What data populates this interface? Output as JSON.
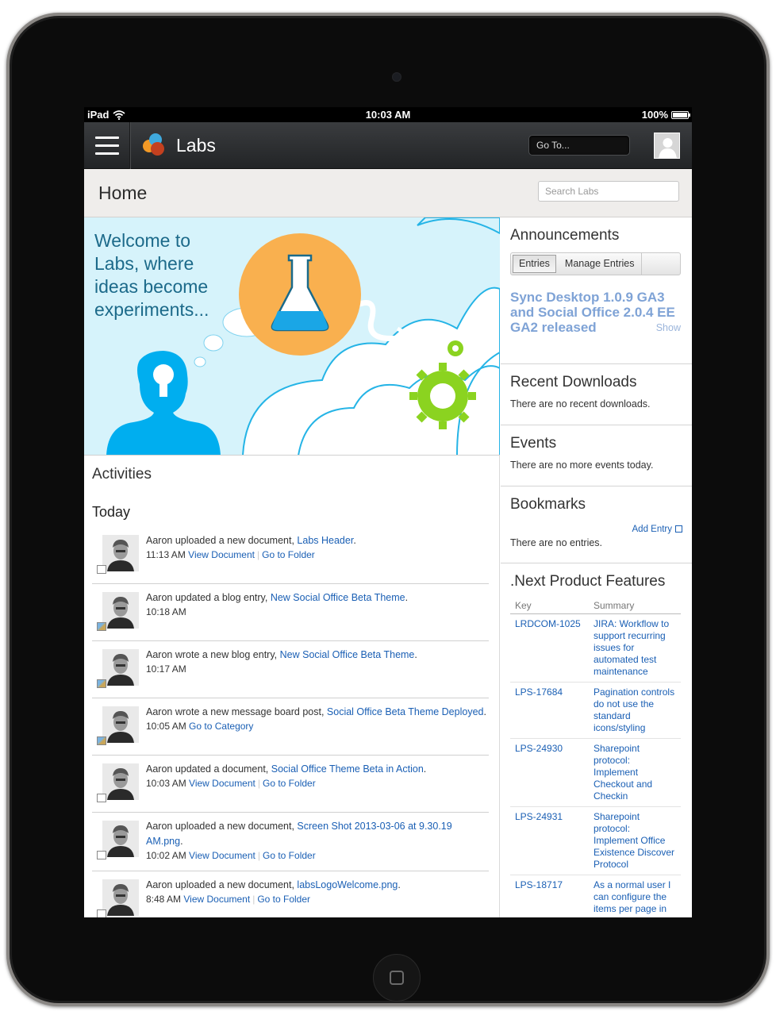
{
  "statusbar": {
    "device": "iPad",
    "time": "10:03 AM",
    "battery": "100%",
    "battery_level": 1.0
  },
  "header": {
    "site_title": "Labs",
    "goto_label": "Go To..."
  },
  "page": {
    "title": "Home",
    "search_placeholder": "Search Labs"
  },
  "banner": {
    "text": "Welcome to Labs, where ideas become experiments..."
  },
  "activities": {
    "title": "Activities",
    "today_label": "Today",
    "items": [
      {
        "text": "Aaron uploaded a new document, ",
        "link": "Labs Header",
        "suffix": ".",
        "time": "11:13 AM",
        "action1": "View Document",
        "action2": "Go to Folder",
        "type": "document"
      },
      {
        "text": "Aaron updated a blog entry, ",
        "link": "New Social Office Beta Theme",
        "suffix": ".",
        "time": "10:18 AM",
        "action1": "",
        "action2": "",
        "type": "blog"
      },
      {
        "text": "Aaron wrote a new blog entry, ",
        "link": "New Social Office Beta Theme",
        "suffix": ".",
        "time": "10:17 AM",
        "action1": "",
        "action2": "",
        "type": "blog"
      },
      {
        "text": "Aaron wrote a new message board post, ",
        "link": "Social Office Beta Theme Deployed",
        "suffix": ".",
        "time": "10:05 AM",
        "action1": "Go to Category",
        "action2": "",
        "type": "message"
      },
      {
        "text": "Aaron updated a document, ",
        "link": "Social Office Theme Beta in Action",
        "suffix": ".",
        "time": "10:03 AM",
        "action1": "View Document",
        "action2": "Go to Folder",
        "type": "document"
      },
      {
        "text": "Aaron uploaded a new document, ",
        "link": "Screen Shot 2013-03-06 at 9.30.19 AM.png",
        "suffix": ".",
        "time": "10:02 AM",
        "action1": "View Document",
        "action2": "Go to Folder",
        "type": "document"
      },
      {
        "text": "Aaron uploaded a new document, ",
        "link": "labsLogoWelcome.png",
        "suffix": ".",
        "time": "8:48 AM",
        "action1": "View Document",
        "action2": "Go to Folder",
        "type": "document"
      }
    ]
  },
  "announcements": {
    "title": "Announcements",
    "tabs": [
      "Entries",
      "Manage Entries"
    ],
    "entry_title": "Sync Desktop 1.0.9 GA3 and Social Office 2.0.4 EE GA2 released",
    "show_label": "Show"
  },
  "recent_downloads": {
    "title": "Recent Downloads",
    "message": "There are no recent downloads."
  },
  "events": {
    "title": "Events",
    "message": "There are no more events today."
  },
  "bookmarks": {
    "title": "Bookmarks",
    "add_entry": "Add Entry",
    "message": "There are no entries."
  },
  "features": {
    "title": ".Next Product Features",
    "columns": [
      "Key",
      "Summary"
    ],
    "rows": [
      {
        "key": "LRDCOM-1025",
        "summary": "JIRA: Workflow to support recurring issues for automated test maintenance"
      },
      {
        "key": "LPS-17684",
        "summary": "Pagination controls do not use the standard icons/styling"
      },
      {
        "key": "LPS-24930",
        "summary": "Sharepoint protocol: Implement Checkout and Checkin"
      },
      {
        "key": "LPS-24931",
        "summary": "Sharepoint protocol: Implement Office Existence Discover Protocol"
      },
      {
        "key": "LPS-18717",
        "summary": "As a normal user I can configure the items per page in"
      }
    ]
  },
  "colors": {
    "accent_link": "#1a5fb4",
    "banner_bg": "#d6f3fb",
    "flask_circle": "#f9b04f",
    "gear": "#8bd320",
    "person": "#00aeef"
  }
}
